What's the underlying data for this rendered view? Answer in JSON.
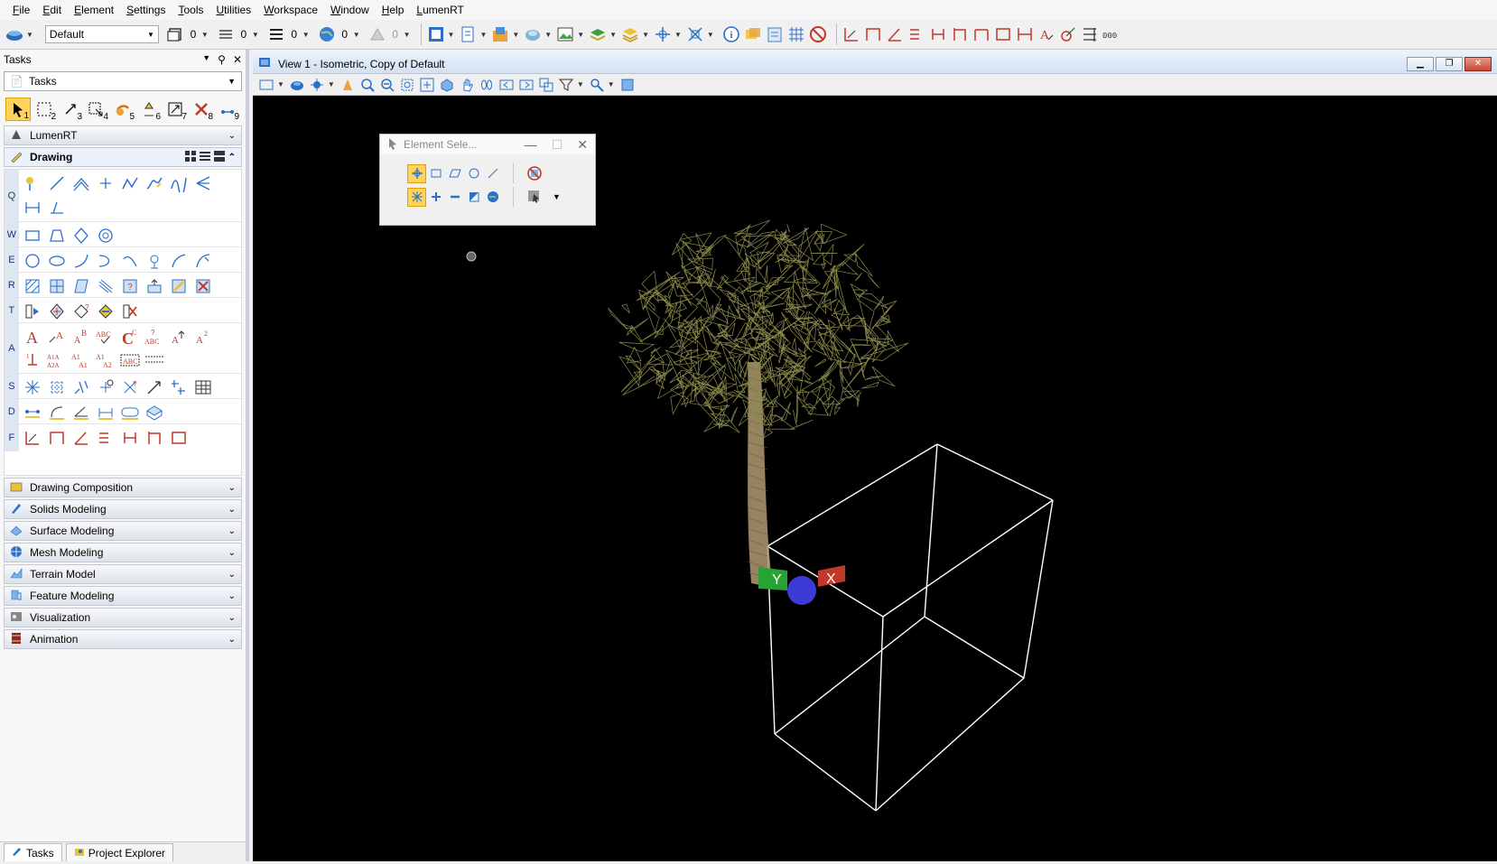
{
  "menubar": {
    "items": [
      "File",
      "Edit",
      "Element",
      "Settings",
      "Tools",
      "Utilities",
      "Workspace",
      "Window",
      "Help",
      "LumenRT"
    ]
  },
  "toolbar": {
    "style_value": "Default",
    "counters": [
      "0",
      "0",
      "0",
      "0",
      "0"
    ]
  },
  "tasks": {
    "panel_title": "Tasks",
    "dropdown_value": "Tasks",
    "selection_keys": [
      "1",
      "2",
      "3",
      "4",
      "5",
      "6",
      "7",
      "8",
      "9"
    ],
    "groups_top": [
      {
        "label": "LumenRT"
      }
    ],
    "drawing_label": "Drawing",
    "row_keys": [
      "Q",
      "W",
      "E",
      "R",
      "T",
      "A",
      "S",
      "D",
      "F"
    ],
    "groups_bottom": [
      {
        "label": "Drawing Composition"
      },
      {
        "label": "Solids Modeling"
      },
      {
        "label": "Surface Modeling"
      },
      {
        "label": "Mesh Modeling"
      },
      {
        "label": "Terrain Model"
      },
      {
        "label": "Feature Modeling"
      },
      {
        "label": "Visualization"
      },
      {
        "label": "Animation"
      }
    ],
    "bottom_tabs": [
      "Tasks",
      "Project Explorer"
    ]
  },
  "view": {
    "title": "View 1 - Isometric, Copy of Default",
    "background": "#000000",
    "box_color": "#ffffff",
    "tree_canopy_color": "#8a8a4a",
    "tree_trunk_color": "#b09a70",
    "axis_x_color": "#c0392b",
    "axis_y_color": "#27a336",
    "axis_x_label": "X",
    "axis_y_label": "Y"
  },
  "element_selection": {
    "title": "Element Sele..."
  },
  "colors": {
    "accent_active": "#ffd35c",
    "panel_border": "#c8cfdb",
    "title_bar": "#d3e1f3"
  }
}
